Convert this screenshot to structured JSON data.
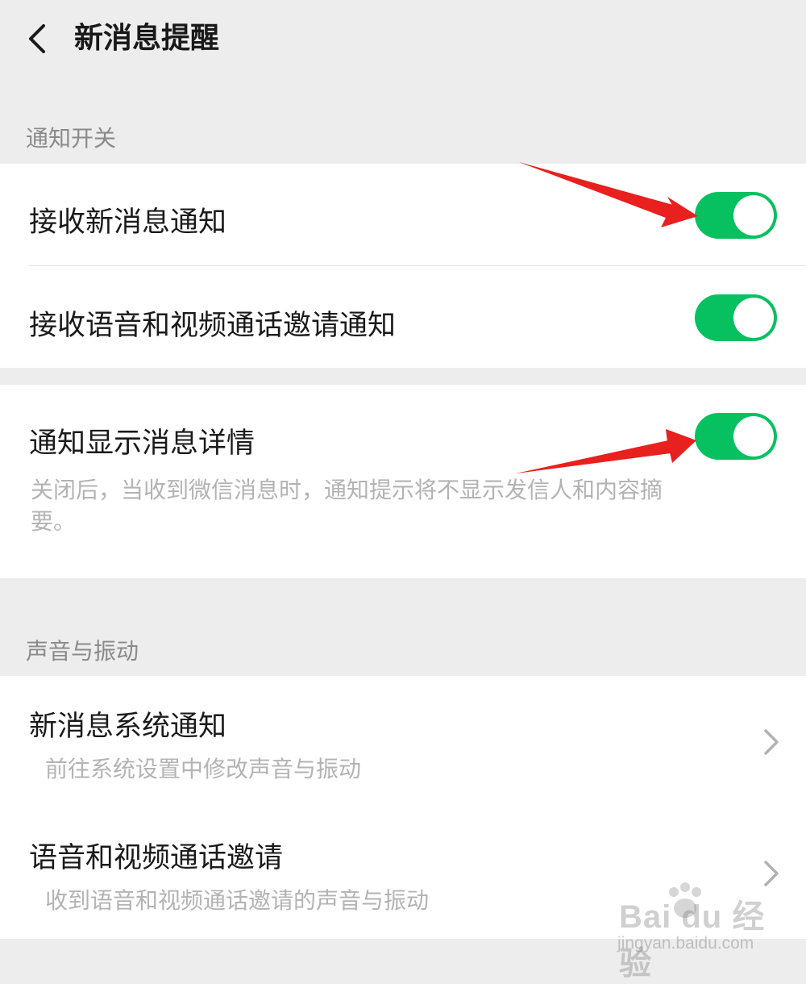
{
  "header": {
    "title": "新消息提醒",
    "back_icon": "chevron-left-icon"
  },
  "colors": {
    "toggle_on": "#07c160",
    "background": "#ededed",
    "card": "#ffffff",
    "annotation_arrow": "#e8201e"
  },
  "section_notifications": {
    "label": "通知开关",
    "items": [
      {
        "title": "接收新消息通知",
        "toggle_on": true
      },
      {
        "title": "接收语音和视频通话邀请通知",
        "toggle_on": true
      }
    ]
  },
  "section_details": {
    "title": "通知显示消息详情",
    "toggle_on": true,
    "desc_line1": "关闭后，当收到微信消息时，通知提示将不显示发信人和内容摘",
    "desc_line2": "要。"
  },
  "section_sound": {
    "label": "声音与振动",
    "items": [
      {
        "title": "新消息系统通知",
        "desc": "前往系统设置中修改声音与振动"
      },
      {
        "title": "语音和视频通话邀请",
        "desc": "收到语音和视频通话邀请的声音与振动"
      }
    ]
  },
  "watermark": {
    "brand": "Bai du 经验",
    "url": "jingyan.baidu.com"
  }
}
